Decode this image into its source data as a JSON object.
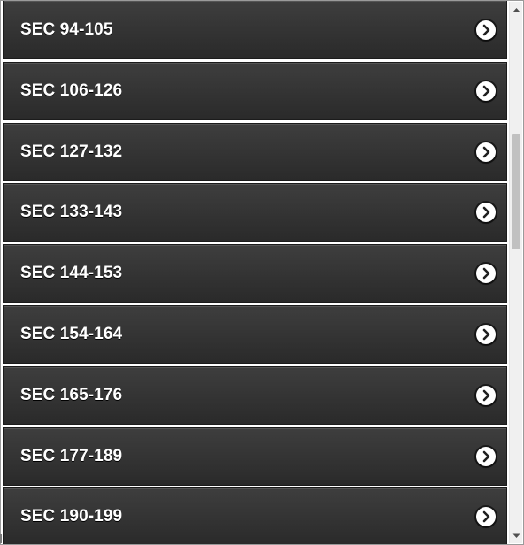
{
  "list": {
    "items": [
      {
        "label": "SEC 94-105"
      },
      {
        "label": "SEC 106-126"
      },
      {
        "label": "SEC 127-132"
      },
      {
        "label": "SEC 133-143"
      },
      {
        "label": "SEC 144-153"
      },
      {
        "label": "SEC 154-164"
      },
      {
        "label": "SEC 165-176"
      },
      {
        "label": "SEC 177-189"
      },
      {
        "label": "SEC 190-199"
      }
    ],
    "item_icon": "chevron-right-icon"
  },
  "scrollbar": {
    "up_icon": "arrow-up-icon",
    "down_icon": "arrow-down-icon"
  },
  "colors": {
    "item_background": "#333333",
    "item_text": "#ffffff",
    "arrow_circle": "#ffffff"
  }
}
